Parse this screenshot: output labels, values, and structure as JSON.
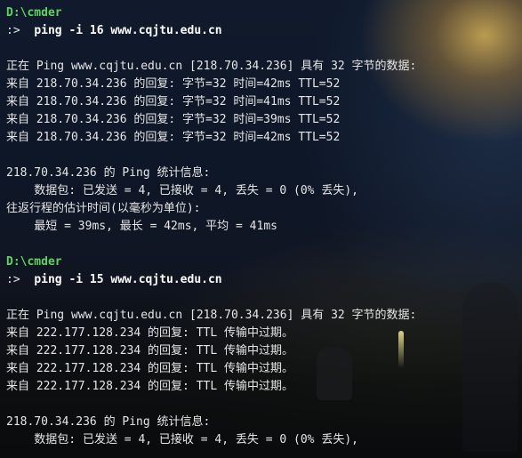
{
  "session1": {
    "prompt_path": "D:\\cmder",
    "prompt_symbol": ":>",
    "command": "ping -i 16 www.cqjtu.edu.cn",
    "header": "正在 Ping www.cqjtu.edu.cn [218.70.34.236] 具有 32 字节的数据:",
    "replies": [
      "来自 218.70.34.236 的回复: 字节=32 时间=42ms TTL=52",
      "来自 218.70.34.236 的回复: 字节=32 时间=41ms TTL=52",
      "来自 218.70.34.236 的回复: 字节=32 时间=39ms TTL=52",
      "来自 218.70.34.236 的回复: 字节=32 时间=42ms TTL=52"
    ],
    "stats_title": "218.70.34.236 的 Ping 统计信息:",
    "stats_packets": "    数据包: 已发送 = 4, 已接收 = 4, 丢失 = 0 (0% 丢失),",
    "rtt_title": "往返行程的估计时间(以毫秒为单位):",
    "rtt_values": "    最短 = 39ms, 最长 = 42ms, 平均 = 41ms"
  },
  "session2": {
    "prompt_path": "D:\\cmder",
    "prompt_symbol": ":>",
    "command": "ping -i 15 www.cqjtu.edu.cn",
    "header": "正在 Ping www.cqjtu.edu.cn [218.70.34.236] 具有 32 字节的数据:",
    "replies": [
      "来自 222.177.128.234 的回复: TTL 传输中过期。",
      "来自 222.177.128.234 的回复: TTL 传输中过期。",
      "来自 222.177.128.234 的回复: TTL 传输中过期。",
      "来自 222.177.128.234 的回复: TTL 传输中过期。"
    ],
    "stats_title": "218.70.34.236 的 Ping 统计信息:",
    "stats_packets": "    数据包: 已发送 = 4, 已接收 = 4, 丢失 = 0 (0% 丢失),"
  },
  "theme": {
    "prompt_color": "#5fd35f",
    "text_color": "#e6e6e6",
    "background": "#0b1220"
  }
}
